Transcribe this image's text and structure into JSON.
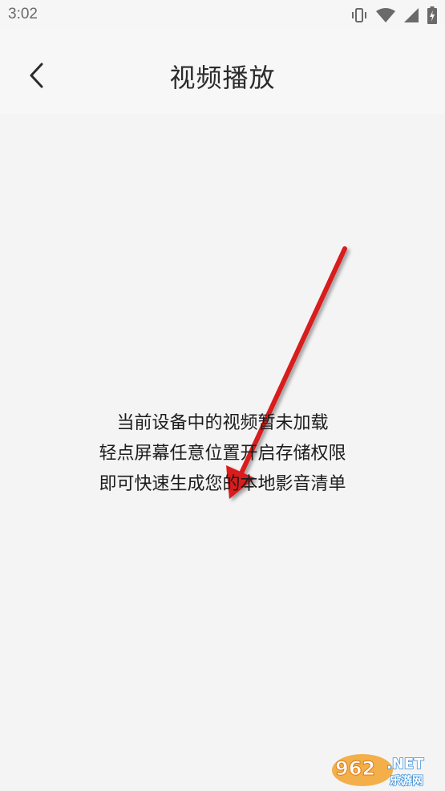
{
  "status_bar": {
    "time": "3:02",
    "icons": [
      "vibrate-icon",
      "wifi-icon",
      "signal-icon",
      "battery-charging-icon"
    ]
  },
  "header": {
    "back_icon": "chevron-left-icon",
    "title": "视频播放"
  },
  "empty_state": {
    "lines": [
      "当前设备中的视频暂未加载",
      "轻点屏幕任意位置开启存储权限",
      "即可快速生成您的本地影音清单"
    ],
    "arrow_color": "#d91e1e"
  },
  "watermark": {
    "brand": "962.NET",
    "subtitle": "乐游网"
  },
  "colors": {
    "background": "#f4f4f5",
    "header": "#f7f7f8",
    "text": "#1c1c1c",
    "title": "#2b2b2b",
    "status_text": "#6a6a6a"
  }
}
